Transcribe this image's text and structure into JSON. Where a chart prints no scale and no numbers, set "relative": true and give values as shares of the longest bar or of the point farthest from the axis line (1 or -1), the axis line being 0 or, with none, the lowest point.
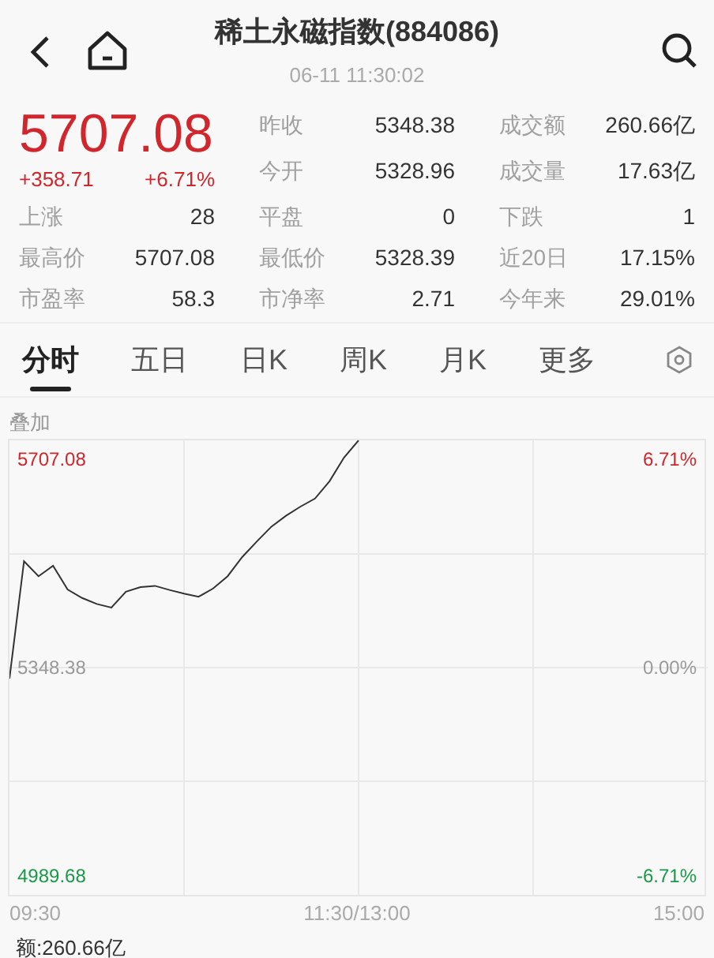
{
  "header": {
    "title": "稀土永磁指数(884086)",
    "time": "06-11 11:30:02"
  },
  "quote": {
    "price": "5707.08",
    "change": "+358.71",
    "change_pct": "+6.71%"
  },
  "stats": [
    [
      {
        "label": "昨收",
        "value": "5348.38"
      },
      {
        "label": "成交额",
        "value": "260.66亿"
      }
    ],
    [
      {
        "label": "今开",
        "value": "5328.96"
      },
      {
        "label": "成交量",
        "value": "17.63亿"
      }
    ],
    [
      {
        "label": "上涨",
        "value": "28"
      },
      {
        "label": "平盘",
        "value": "0"
      },
      {
        "label": "下跌",
        "value": "1"
      }
    ],
    [
      {
        "label": "最高价",
        "value": "5707.08"
      },
      {
        "label": "最低价",
        "value": "5328.39"
      },
      {
        "label": "近20日",
        "value": "17.15%"
      }
    ],
    [
      {
        "label": "市盈率",
        "value": "58.3"
      },
      {
        "label": "市净率",
        "value": "2.71"
      },
      {
        "label": "今年来",
        "value": "29.01%"
      }
    ]
  ],
  "tabs": [
    {
      "label": "分时",
      "selected": true
    },
    {
      "label": "五日",
      "selected": false
    },
    {
      "label": "日K",
      "selected": false
    },
    {
      "label": "周K",
      "selected": false
    },
    {
      "label": "月K",
      "selected": false
    },
    {
      "label": "更多",
      "selected": false
    }
  ],
  "overlay_label": "叠加",
  "chart": {
    "price_labels": [
      "5707.08",
      "5348.38",
      "4989.68"
    ],
    "percent_labels": [
      "6.71%",
      "0.00%",
      "-6.71%"
    ],
    "time_labels": [
      "09:30",
      "11:30/13:00",
      "15:00"
    ],
    "chart_data": {
      "type": "line",
      "relative": true,
      "grid": true,
      "categories": [
        null,
        null,
        null,
        null,
        null,
        null,
        null,
        null,
        null,
        null,
        null,
        null,
        null,
        null,
        null,
        null,
        null,
        null,
        null,
        null,
        null,
        null,
        null,
        null,
        null,
        null,
        null,
        null,
        null,
        null,
        null,
        null,
        null,
        null,
        null,
        null,
        null,
        null,
        null,
        null,
        null,
        null,
        null,
        null,
        null,
        null,
        null,
        null,
        null
      ],
      "series": [
        {
          "color": "#333333",
          "values": [
            0.476,
            0.734,
            0.701,
            0.724,
            0.672,
            0.653,
            0.64,
            0.632,
            0.667,
            0.677,
            0.68,
            0.671,
            0.663,
            0.656,
            0.674,
            0.701,
            0.743,
            0.777,
            0.81,
            0.834,
            0.854,
            0.872,
            0.91,
            0.962,
            1.0,
            null,
            null,
            null,
            null,
            null,
            null,
            null,
            null,
            null,
            null,
            null,
            null,
            null,
            null,
            null,
            null,
            null,
            null,
            null,
            null,
            null,
            null,
            null,
            null
          ]
        }
      ]
    }
  },
  "turnover": "额:260.66亿"
}
